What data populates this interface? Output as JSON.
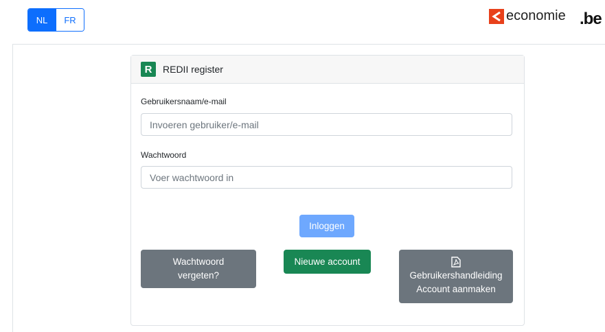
{
  "header": {
    "languages": [
      {
        "label": "NL",
        "active": true
      },
      {
        "label": "FR",
        "active": false
      }
    ],
    "logo_economie": "economie",
    "logo_be": ".be",
    "colors": {
      "primary": "#0d6efd",
      "economie_red": "#e8411b"
    }
  },
  "card": {
    "badge": "R",
    "title": "REDII register",
    "username": {
      "label": "Gebruikersnaam/e-mail",
      "placeholder": "Invoeren gebruiker/e-mail"
    },
    "password": {
      "label": "Wachtwoord",
      "placeholder": "Voer wachtwoord in"
    },
    "login_button": "Inloggen",
    "forgot_button": [
      "Wachtwoord",
      "vergeten?"
    ],
    "new_account_button": "Nieuwe account",
    "manual_button": [
      "Gebruikershandleiding",
      "Account aanmaken"
    ],
    "icons": {
      "manual": "pdf-icon"
    },
    "colors": {
      "success": "#198754",
      "secondary": "#6c757d",
      "login": "#6ea8fe"
    }
  }
}
